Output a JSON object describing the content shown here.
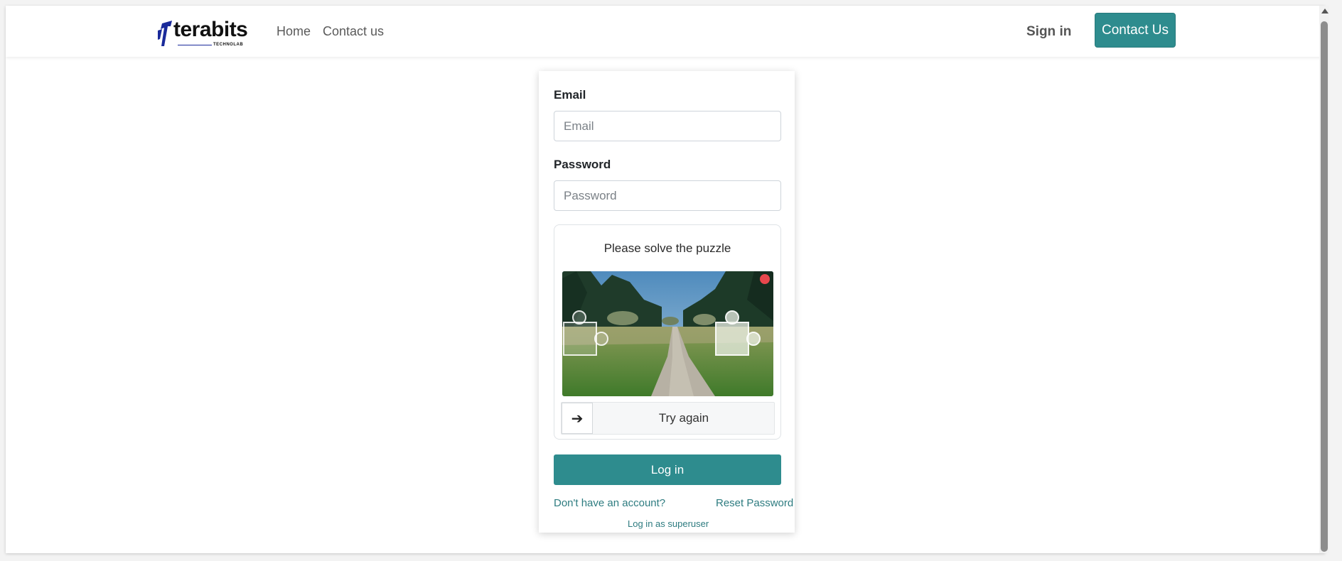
{
  "navbar": {
    "logo_text": "terabits",
    "logo_subtext": "TECHNOLAB",
    "links": [
      {
        "label": "Home"
      },
      {
        "label": "Contact us"
      }
    ],
    "signin_label": "Sign in",
    "contact_button_label": "Contact Us"
  },
  "form": {
    "email_label": "Email",
    "email_placeholder": "Email",
    "email_value": "",
    "password_label": "Password",
    "password_placeholder": "Password",
    "password_value": "",
    "captcha": {
      "title": "Please solve the puzzle",
      "slider_label": "Try again",
      "handle_icon": "arrow-right-icon",
      "close_indicator_color": "#e8474d"
    },
    "login_label": "Log in",
    "signup_link": "Don't have an account?",
    "reset_link": "Reset Password",
    "superuser_link": "Log in as superuser"
  },
  "colors": {
    "brand": "#2e8c8e",
    "link": "#2e7c80",
    "logo_blue": "#1a2a9a"
  }
}
